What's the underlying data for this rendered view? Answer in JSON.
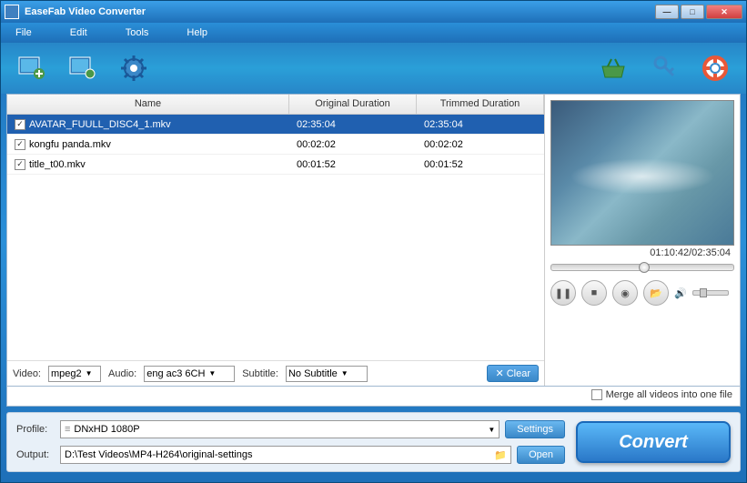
{
  "titlebar": {
    "title": "EaseFab Video Converter"
  },
  "menu": {
    "file": "File",
    "edit": "Edit",
    "tools": "Tools",
    "help": "Help"
  },
  "table": {
    "headers": {
      "name": "Name",
      "orig": "Original Duration",
      "trim": "Trimmed Duration"
    },
    "rows": [
      {
        "name": "AVATAR_FUULL_DISC4_1.mkv",
        "orig": "02:35:04",
        "trim": "02:35:04",
        "checked": true,
        "selected": true
      },
      {
        "name": "kongfu panda.mkv",
        "orig": "00:02:02",
        "trim": "00:02:02",
        "checked": true,
        "selected": false
      },
      {
        "name": "title_t00.mkv",
        "orig": "00:01:52",
        "trim": "00:01:52",
        "checked": true,
        "selected": false
      }
    ]
  },
  "footer": {
    "video_label": "Video:",
    "video_value": "mpeg2",
    "audio_label": "Audio:",
    "audio_value": "eng ac3 6CH",
    "subtitle_label": "Subtitle:",
    "subtitle_value": "No Subtitle",
    "clear": "Clear"
  },
  "preview": {
    "time": "01:10:42/02:35:04"
  },
  "merge": {
    "label": "Merge all videos into one file",
    "checked": false
  },
  "bottom": {
    "profile_label": "Profile:",
    "profile_value": "DNxHD 1080P",
    "output_label": "Output:",
    "output_value": "D:\\Test Videos\\MP4-H264\\original-settings",
    "settings": "Settings",
    "open": "Open",
    "convert": "Convert"
  }
}
